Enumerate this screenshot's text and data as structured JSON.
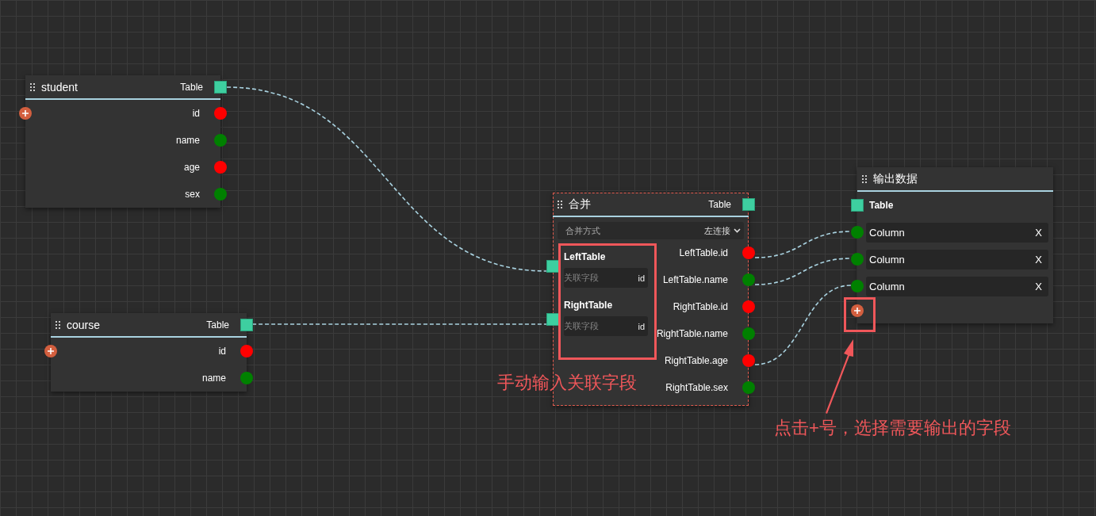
{
  "nodes": [
    {
      "kind": "source",
      "title": "student",
      "output": "Table",
      "selected": false,
      "fields": [
        {
          "name": "id",
          "color": "#ff0000"
        },
        {
          "name": "name",
          "color": "#008000"
        },
        {
          "name": "age",
          "color": "#ff0000"
        },
        {
          "name": "sex",
          "color": "#008000"
        }
      ]
    },
    {
      "kind": "source",
      "title": "course",
      "output": "Table",
      "selected": false,
      "fields": [
        {
          "name": "id",
          "color": "#ff0000"
        },
        {
          "name": "name",
          "color": "#008000"
        }
      ]
    },
    {
      "kind": "merge",
      "title": "合并",
      "output": "Table",
      "selected": true,
      "join_mode": {
        "label": "合并方式",
        "value": "左连接"
      },
      "inputs": [
        {
          "label": "LeftTable",
          "key_label": "关联字段",
          "key_value": "id"
        },
        {
          "label": "RightTable",
          "key_label": "关联字段",
          "key_value": "id"
        }
      ],
      "fields": [
        {
          "name": "LeftTable.id",
          "color": "#ff0000"
        },
        {
          "name": "LeftTable.name",
          "color": "#008000"
        },
        {
          "name": "RightTable.id",
          "color": "#ff0000"
        },
        {
          "name": "RightTable.name",
          "color": "#008000"
        },
        {
          "name": "RightTable.age",
          "color": "#ff0000"
        },
        {
          "name": "RightTable.sex",
          "color": "#008000"
        }
      ]
    },
    {
      "kind": "output",
      "title": "输出数据",
      "input": "Table",
      "selected": false,
      "columns": [
        {
          "label": "Column",
          "remove": "X",
          "color": "#008000"
        },
        {
          "label": "Column",
          "remove": "X",
          "color": "#008000"
        },
        {
          "label": "Column",
          "remove": "X",
          "color": "#008000"
        }
      ]
    }
  ],
  "annotations": [
    "手动输入关联字段",
    "点击+号，选择需要输出的字段"
  ]
}
